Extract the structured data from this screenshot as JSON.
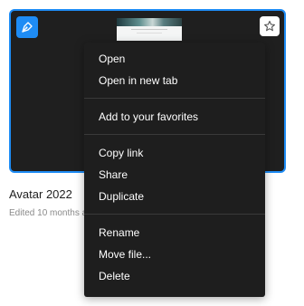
{
  "file": {
    "name": "Avatar 2022",
    "meta": "Edited 10 months ago"
  },
  "icons": {
    "type_badge": "pen-tool-icon",
    "favorite": "star-icon"
  },
  "colors": {
    "accent": "#1e8cf5",
    "card_background": "#1f1f1f",
    "menu_background": "#1e1e1e"
  },
  "menu": {
    "groups": [
      [
        {
          "label": "Open"
        },
        {
          "label": "Open in new tab"
        }
      ],
      [
        {
          "label": "Add to your favorites"
        }
      ],
      [
        {
          "label": "Copy link"
        },
        {
          "label": "Share"
        },
        {
          "label": "Duplicate"
        }
      ],
      [
        {
          "label": "Rename"
        },
        {
          "label": "Move file..."
        },
        {
          "label": "Delete"
        }
      ]
    ]
  }
}
